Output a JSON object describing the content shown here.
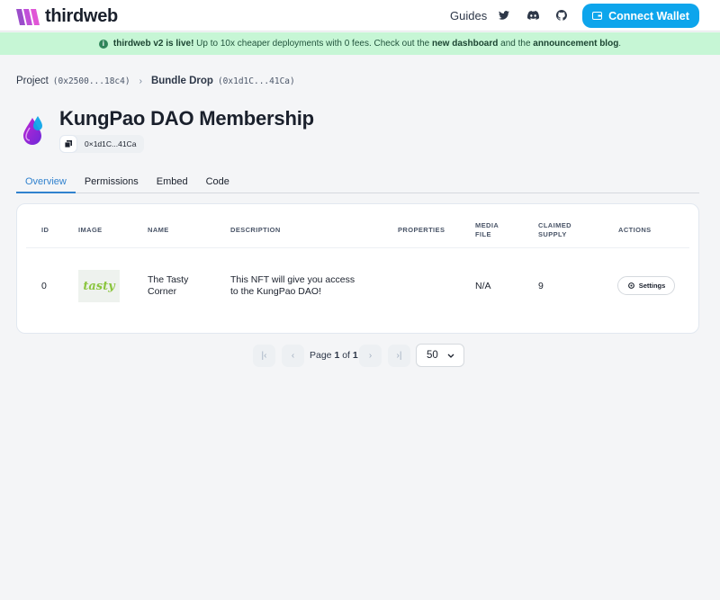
{
  "header": {
    "logo_text": "thirdweb",
    "nav_guides": "Guides",
    "icons": [
      "twitter-icon",
      "discord-icon",
      "github-icon"
    ],
    "connect_label": "Connect Wallet",
    "accent": "#0da5ec"
  },
  "banner": {
    "lead": "thirdweb v2 is live!",
    "text1": " Up to 10x cheaper deployments with 0 fees. Check out the ",
    "link1": "new dashboard",
    "text2": " and the ",
    "link2": "announcement blog",
    "end": ".",
    "bg": "#c6f6d5"
  },
  "breadcrumb": {
    "project_label": "Project",
    "project_addr": "(0x2500...18c4)",
    "bundle_label": "Bundle Drop",
    "bundle_addr": "(0x1d1C...41Ca)"
  },
  "title": "KungPao DAO Membership",
  "address_chip": "0×1d1C...41Ca",
  "tabs": [
    {
      "label": "Overview",
      "active": true
    },
    {
      "label": "Permissions",
      "active": false
    },
    {
      "label": "Embed",
      "active": false
    },
    {
      "label": "Code",
      "active": false
    }
  ],
  "table": {
    "headers": {
      "id": "ID",
      "image": "IMAGE",
      "name": "NAME",
      "description": "DESCRIPTION",
      "properties": "PROPERTIES",
      "media_file_1": "MEDIA",
      "media_file_2": "FILE",
      "claimed_1": "CLAIMED",
      "claimed_2": "SUPPLY",
      "actions": "ACTIONS"
    },
    "rows": [
      {
        "id": "0",
        "image_text": "tasty",
        "name_1": "The Tasty",
        "name_2": "Corner",
        "desc_1": "This NFT will give you access",
        "desc_2": "to the KungPao DAO!",
        "properties": "",
        "media_file": "N/A",
        "claimed_supply": "9",
        "action_label": "Settings"
      }
    ]
  },
  "pagination": {
    "page_prefix": "Page ",
    "page_current": "1",
    "page_of": " of ",
    "page_total": "1",
    "page_size": "50"
  }
}
